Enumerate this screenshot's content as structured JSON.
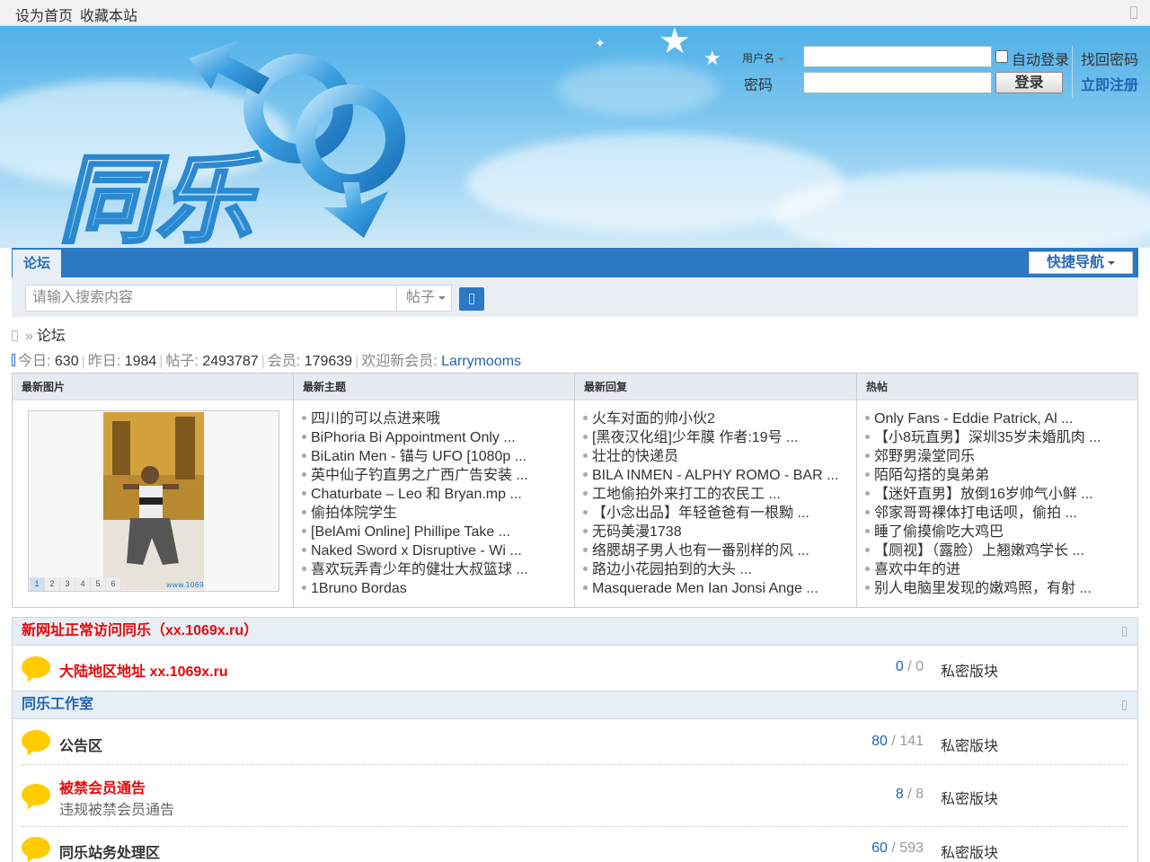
{
  "topbar": {
    "set_home": "设为首页",
    "bookmark": "收藏本站"
  },
  "login": {
    "username_label": "用户名",
    "password_label": "密码",
    "auto_login": "自动登录",
    "login_button": "登录",
    "find_password": "找回密码",
    "register": "立即注册",
    "username_value": "",
    "password_value": ""
  },
  "nav": {
    "tab_forum": "论坛",
    "quick_nav": "快捷导航"
  },
  "search": {
    "placeholder": "请输入搜索内容",
    "type": "帖子"
  },
  "breadcrumb": {
    "raquo": "»",
    "current": "论坛"
  },
  "stats": {
    "today_label": "今日:",
    "today": "630",
    "yesterday_label": "昨日:",
    "yesterday": "1984",
    "posts_label": "帖子:",
    "posts": "2493787",
    "members_label": "会员:",
    "members": "179639",
    "new_member_label": "欢迎新会员:",
    "new_member": "Larrymooms",
    "separator": "|"
  },
  "portal": {
    "latest_images": {
      "title": "最新图片",
      "pages": [
        "1",
        "2",
        "3",
        "4",
        "5",
        "6"
      ],
      "watermark": "www.1069x.ru"
    },
    "latest_topics": {
      "title": "最新主题",
      "items": [
        "四川的可以点进来哦",
        "BiPhoria Bi Appointment Only ...",
        "BiLatin Men - 锚与 UFO [1080p ...",
        "英中仙子钓直男之广西广告安装 ...",
        "Chaturbate – Leo 和 Bryan.mp ...",
        "偷拍体院学生",
        "[BelAmi Online] Phillipe Take ...",
        "Naked Sword x Disruptive - Wi ...",
        "喜欢玩弄青少年的健壮大叔篮球 ...",
        "1Bruno Bordas"
      ]
    },
    "latest_replies": {
      "title": "最新回复",
      "items": [
        "火车对面的帅小伙2",
        "[黑夜汉化组]少年膜 作者:19号 ...",
        "壮壮的快递员",
        "BILA INMEN - ALPHY ROMO - BAR ...",
        "工地偷拍外来打工的农民工 ...",
        "【小念出品】年轻爸爸有一根黝 ...",
        "无码美漫1738",
        "络腮胡子男人也有一番别样的风 ...",
        "路边小花园拍到的大头 ...",
        "Masquerade Men Ian Jonsi Ange ..."
      ]
    },
    "hot_posts": {
      "title": "热帖",
      "items": [
        "Only Fans - Eddie Patrick, Al ...",
        "【小8玩直男】深圳35岁未婚肌肉 ...",
        "郊野男澡堂同乐",
        "陌陌勾搭的臭弟弟",
        "【迷奸直男】放倒16岁帅气小鲜 ...",
        "邻家哥哥裸体打电话呗，偷拍 ...",
        "睡了偷摸偷吃大鸡巴",
        "【厕视】（露脸）上翘嫩鸡学长 ...",
        "喜欢中年的进",
        "别人电脑里发现的嫩鸡照，有射 ..."
      ]
    }
  },
  "sections": [
    {
      "title": "新网址正常访问同乐（xx.1069x.ru）",
      "title_color": "#e20a0a",
      "forums": [
        {
          "name": "大陆地区地址 xx.1069x.ru",
          "desc": "",
          "threads": "0",
          "posts": "0",
          "access": "私密版块",
          "red": true
        }
      ]
    },
    {
      "title": "同乐工作室",
      "title_color": "#2164b4",
      "forums": [
        {
          "name": "公告区",
          "desc": "",
          "threads": "80",
          "posts": "141",
          "access": "私密版块",
          "red": false
        },
        {
          "name": "被禁会员通告",
          "desc": "违规被禁会员通告",
          "threads": "8",
          "posts": "8",
          "access": "私密版块",
          "red": true
        },
        {
          "name": "同乐站务处理区",
          "desc": "",
          "threads": "60",
          "posts": "593",
          "access": "私密版块",
          "red": false
        }
      ]
    }
  ],
  "logo_text": "同乐",
  "colors": {
    "nav_blue": "#2b78c5",
    "link_blue": "#2164b4",
    "alert_red": "#e20a0a",
    "forum_icon": "#ffcc00"
  }
}
